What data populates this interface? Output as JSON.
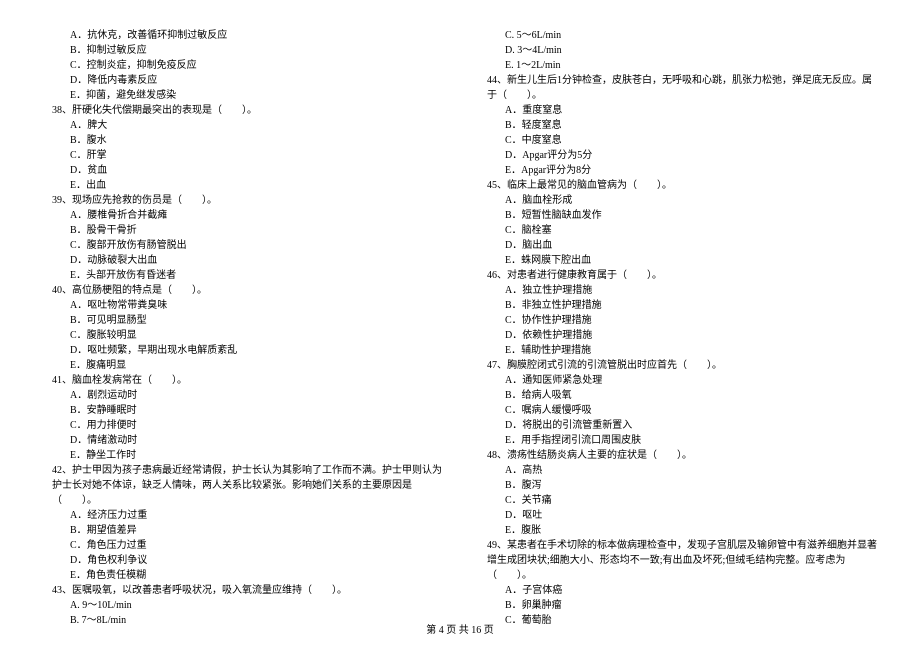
{
  "left_column": {
    "q37_options": [
      "A．抗休克，改善循环抑制过敏反应",
      "B．抑制过敏反应",
      "C．控制炎症，抑制免疫反应",
      "D．降低内毒素反应",
      "E．抑菌，避免继发感染"
    ],
    "q38": {
      "text": "38、肝硬化失代偿期最突出的表现是（　　）。",
      "options": [
        "A．脾大",
        "B．腹水",
        "C．肝掌",
        "D．贫血",
        "E．出血"
      ]
    },
    "q39": {
      "text": "39、现场应先抢救的伤员是（　　）。",
      "options": [
        "A．腰椎骨折合并截瘫",
        "B．股骨干骨折",
        "C．腹部开放伤有肠管脱出",
        "D．动脉破裂大出血",
        "E．头部开放伤有昏迷者"
      ]
    },
    "q40": {
      "text": "40、高位肠梗阻的特点是（　　）。",
      "options": [
        "A．呕吐物常带粪臭味",
        "B．可见明显肠型",
        "C．腹胀较明显",
        "D．呕吐频繁，早期出现水电解质紊乱",
        "E．腹痛明显"
      ]
    },
    "q41": {
      "text": "41、脑血栓发病常在（　　）。",
      "options": [
        "A．剧烈运动时",
        "B．安静睡眠时",
        "C．用力排便时",
        "D．情绪激动时",
        "E．静坐工作时"
      ]
    },
    "q42": {
      "text": "42、护士甲因为孩子患病最近经常请假，护士长认为其影响了工作而不满。护士甲则认为护士长对她不体谅，缺乏人情味，两人关系比较紧张。影响她们关系的主要原因是（　　）。",
      "options": [
        "A．经济压力过重",
        "B．期望值差异",
        "C．角色压力过重",
        "D．角色权利争议",
        "E．角色责任模糊"
      ]
    },
    "q43": {
      "text": "43、医嘱吸氧，以改善患者呼吸状况，吸入氧流量应维持（　　）。",
      "options": [
        "A. 9～10L/min",
        "B. 7～8L/min"
      ]
    }
  },
  "right_column": {
    "q43_options_cont": [
      "C. 5～6L/min",
      "D. 3～4L/min",
      "E. 1～2L/min"
    ],
    "q44": {
      "text": "44、新生儿生后1分钟检查，皮肤苍白，无呼吸和心跳，肌张力松弛，弹足底无反应。属于（　　）。",
      "options": [
        "A．重度窒息",
        "B．轻度窒息",
        "C．中度窒息",
        "D．Apgar评分为5分",
        "E．Apgar评分为8分"
      ]
    },
    "q45": {
      "text": "45、临床上最常见的脑血管病为（　　）。",
      "options": [
        "A．脑血栓形成",
        "B．短暂性脑缺血发作",
        "C．脑栓塞",
        "D．脑出血",
        "E．蛛网膜下腔出血"
      ]
    },
    "q46": {
      "text": "46、对患者进行健康教育属于（　　）。",
      "options": [
        "A．独立性护理措施",
        "B．非独立性护理措施",
        "C．协作性护理措施",
        "D．依赖性护理措施",
        "E．辅助性护理措施"
      ]
    },
    "q47": {
      "text": "47、胸膜腔闭式引流的引流管脱出时应首先（　　）。",
      "options": [
        "A．通知医师紧急处理",
        "B．给病人吸氧",
        "C．嘱病人缓慢呼吸",
        "D．将脱出的引流管重新置入",
        "E．用手指捏闭引流口周围皮肤"
      ]
    },
    "q48": {
      "text": "48、溃疡性结肠炎病人主要的症状是（　　）。",
      "options": [
        "A．高热",
        "B．腹泻",
        "C．关节痛",
        "D．呕吐",
        "E．腹胀"
      ]
    },
    "q49": {
      "text": "49、某患者在手术切除的标本做病理检查中，发现子宫肌层及输卵管中有滋养细胞并显著增生成团块状;细胞大小、形态均不一致;有出血及坏死;但绒毛结构完整。应考虑为（　　）。",
      "options": [
        "A．子宫体癌",
        "B．卵巢肿瘤",
        "C．葡萄胎"
      ]
    }
  },
  "footer": "第 4 页 共 16 页"
}
